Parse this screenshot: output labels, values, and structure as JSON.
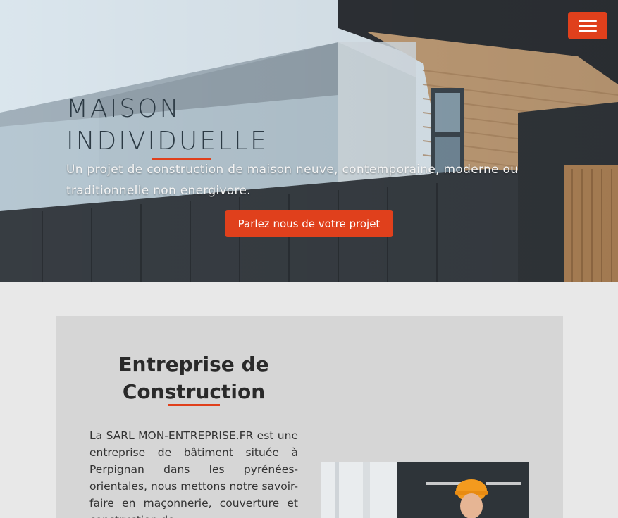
{
  "hero": {
    "title_line1": "Maison",
    "title_line2": "individuelle",
    "subtitle": "Un projet de construction de maison neuve, contemporaine, moderne ou traditionnelle non energivore.",
    "cta_label": "Parlez nous de votre projet"
  },
  "nav": {
    "menu_icon": "hamburger-icon"
  },
  "section": {
    "title": "Entreprise de Construction",
    "text": "La SARL MON-ENTREPRISE.FR est une entreprise de bâtiment située à Perpignan dans les pyrénées-orientales, nous mettons notre savoir-faire en maçonnerie, couverture et construction de"
  },
  "colors": {
    "accent": "#e0401c",
    "card_bg": "#d6d6d6",
    "page_bg": "#e8e8e8"
  }
}
